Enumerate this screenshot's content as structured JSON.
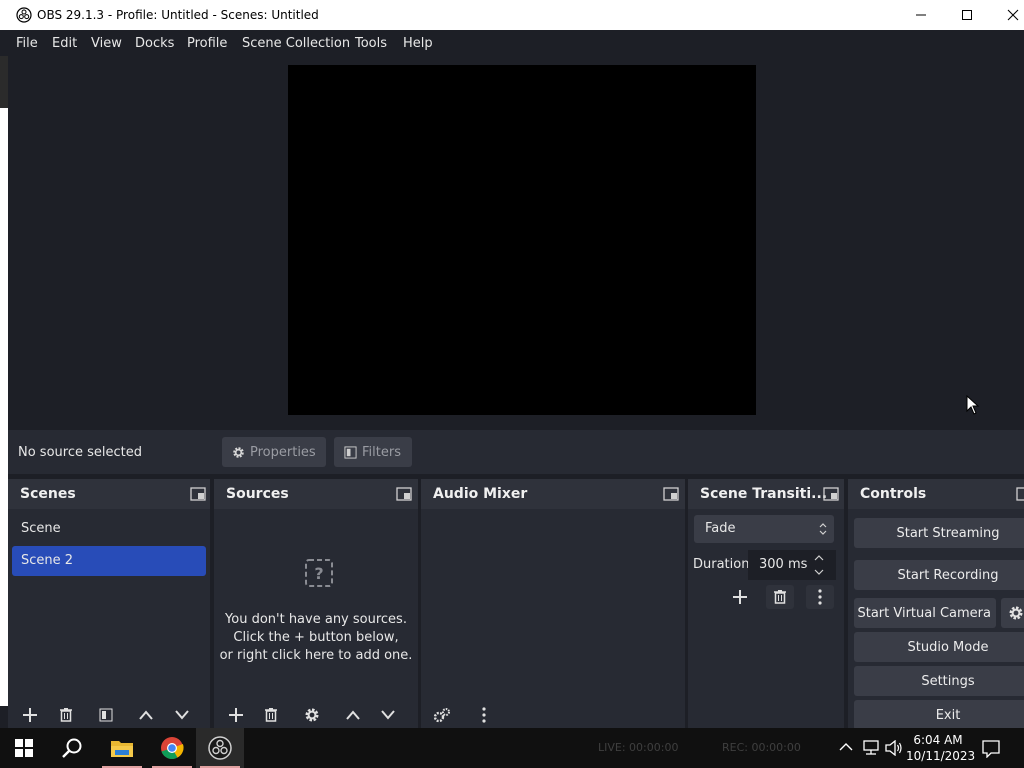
{
  "window": {
    "title": "OBS 29.1.3 - Profile: Untitled - Scenes: Untitled"
  },
  "menu": [
    "File",
    "Edit",
    "View",
    "Docks",
    "Profile",
    "Scene Collection",
    "Tools",
    "Help"
  ],
  "context": {
    "no_source": "No source selected",
    "properties": "Properties",
    "filters": "Filters"
  },
  "docks": {
    "scenes": {
      "title": "Scenes",
      "items": [
        "Scene",
        "Scene 2"
      ],
      "selected_index": 1
    },
    "sources": {
      "title": "Sources",
      "empty_lines": [
        "You don't have any sources.",
        "Click the + button below,",
        "or right click here to add one."
      ]
    },
    "audio": {
      "title": "Audio Mixer"
    },
    "transitions": {
      "title": "Scene Transiti...",
      "type": "Fade",
      "duration_label": "Duration",
      "duration_value": "300 ms"
    },
    "controls": {
      "title": "Controls",
      "start_streaming": "Start Streaming",
      "start_recording": "Start Recording",
      "start_virtual_camera": "Start Virtual Camera",
      "studio_mode": "Studio Mode",
      "settings": "Settings",
      "exit": "Exit"
    }
  },
  "status": {
    "live": "LIVE: 00:00:00",
    "rec": "REC: 00:00:00"
  },
  "clock": {
    "time": "6:04 AM",
    "date": "10/11/2023"
  },
  "colors": {
    "selected": "#284cb8",
    "panel": "#272a33",
    "background": "#1d1f26"
  }
}
